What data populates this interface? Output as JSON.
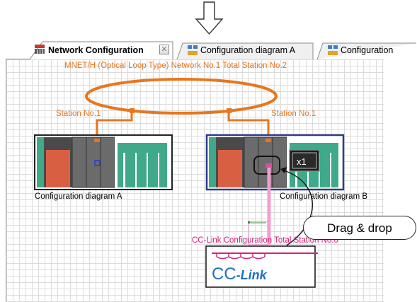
{
  "tabs": [
    {
      "label": "Network Configuration",
      "active": true,
      "close_glyph": "✕"
    },
    {
      "label": "Configuration diagram A",
      "active": false
    },
    {
      "label": "Configuration",
      "active": false
    }
  ],
  "canvas": {
    "network_title": "MNET/H (Optical Loop Type)  Network No.1  Total Station No.2",
    "station_left": "Station No.1",
    "station_right": "Station No.1",
    "config_a_label": "Configuration diagram A",
    "config_b_label": "Configuration diagram B",
    "cclink_title": "CC-Link Configuration  Total Station No.0",
    "cclink_logo_prefix": "CC",
    "cclink_logo_suffix": "-Link",
    "x1_badge": "x1"
  },
  "callout": {
    "text": "Drag & drop"
  },
  "colors": {
    "orange": "#e8761e",
    "magenta": "#d4237a",
    "module_dark": "#6b6b6b",
    "power_red": "#d95f43",
    "io_green": "#3fa98a",
    "cclink_blue": "#1f6fc6"
  },
  "icons": [
    "down-arrow-icon",
    "network-icon",
    "diagram-icon",
    "close-icon",
    "x1-badge-icon"
  ]
}
